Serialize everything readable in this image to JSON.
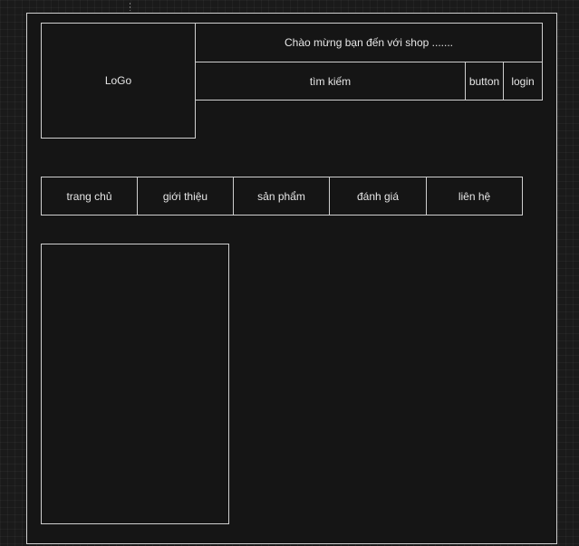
{
  "header": {
    "logo": "LoGo",
    "welcome": "Chào mừng bạn đến với shop .......",
    "search": "tìm kiếm",
    "button": "button",
    "login": "login"
  },
  "nav": {
    "items": [
      "trang chủ",
      "giới thiệu",
      "sản phẩm",
      "đánh giá",
      "liên hệ"
    ]
  }
}
